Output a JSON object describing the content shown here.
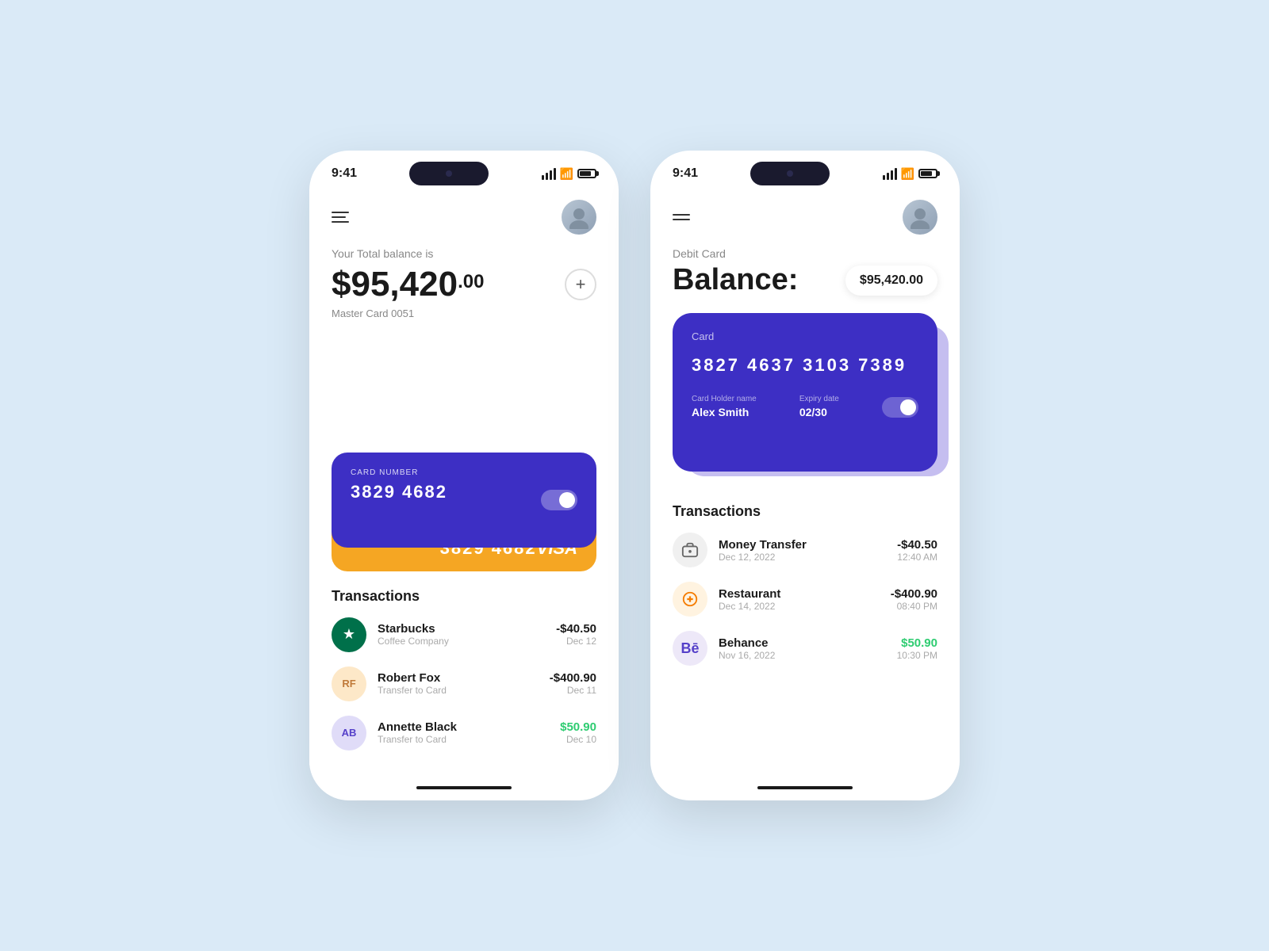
{
  "app": {
    "background": "#daeaf7"
  },
  "phone1": {
    "status_time": "9:41",
    "balance_label": "Your Total balance is",
    "balance_main": "$95,420",
    "balance_cents": ".00",
    "card_sub_label": "Master Card 0051",
    "add_button_label": "+",
    "card1": {
      "label": "CARD NUMBER",
      "number": "3829 4682",
      "type": "purple"
    },
    "card2": {
      "label": "CARD NUMBER",
      "number": "3829 4682",
      "brand": "VISA",
      "type": "yellow"
    },
    "transactions_title": "Transactions",
    "transactions": [
      {
        "name": "Starbucks",
        "sub": "Coffee Company",
        "amount": "-$40.50",
        "date": "Dec 12",
        "type": "negative",
        "icon_type": "starbucks"
      },
      {
        "name": "Robert Fox",
        "sub": "Transfer to Card",
        "amount": "-$400.90",
        "date": "Dec 11",
        "type": "negative",
        "icon_type": "rf"
      },
      {
        "name": "Annette Black",
        "sub": "Transfer to Card",
        "amount": "$50.90",
        "date": "Dec 10",
        "type": "positive",
        "icon_type": "ab"
      }
    ]
  },
  "phone2": {
    "status_time": "9:41",
    "debit_label": "Debit Card",
    "balance_heading": "Balance:",
    "balance_badge": "$95,420.00",
    "card": {
      "label": "Card",
      "number": "3827 4637 3103 7389",
      "holder_label": "Card Holder name",
      "holder_name": "Alex Smith",
      "expiry_label": "Expiry date",
      "expiry": "02/30"
    },
    "transactions_title": "Transactions",
    "transactions": [
      {
        "name": "Money Transfer",
        "sub": "Dec 12, 2022",
        "amount": "-$40.50",
        "time": "12:40 AM",
        "type": "negative",
        "icon_type": "wallet"
      },
      {
        "name": "Restaurant",
        "sub": "Dec 14, 2022",
        "amount": "-$400.90",
        "time": "08:40 PM",
        "type": "negative",
        "icon_type": "restaurant"
      },
      {
        "name": "Behance",
        "sub": "Nov 16, 2022",
        "amount": "$50.90",
        "time": "10:30 PM",
        "type": "positive",
        "icon_type": "behance"
      }
    ]
  }
}
